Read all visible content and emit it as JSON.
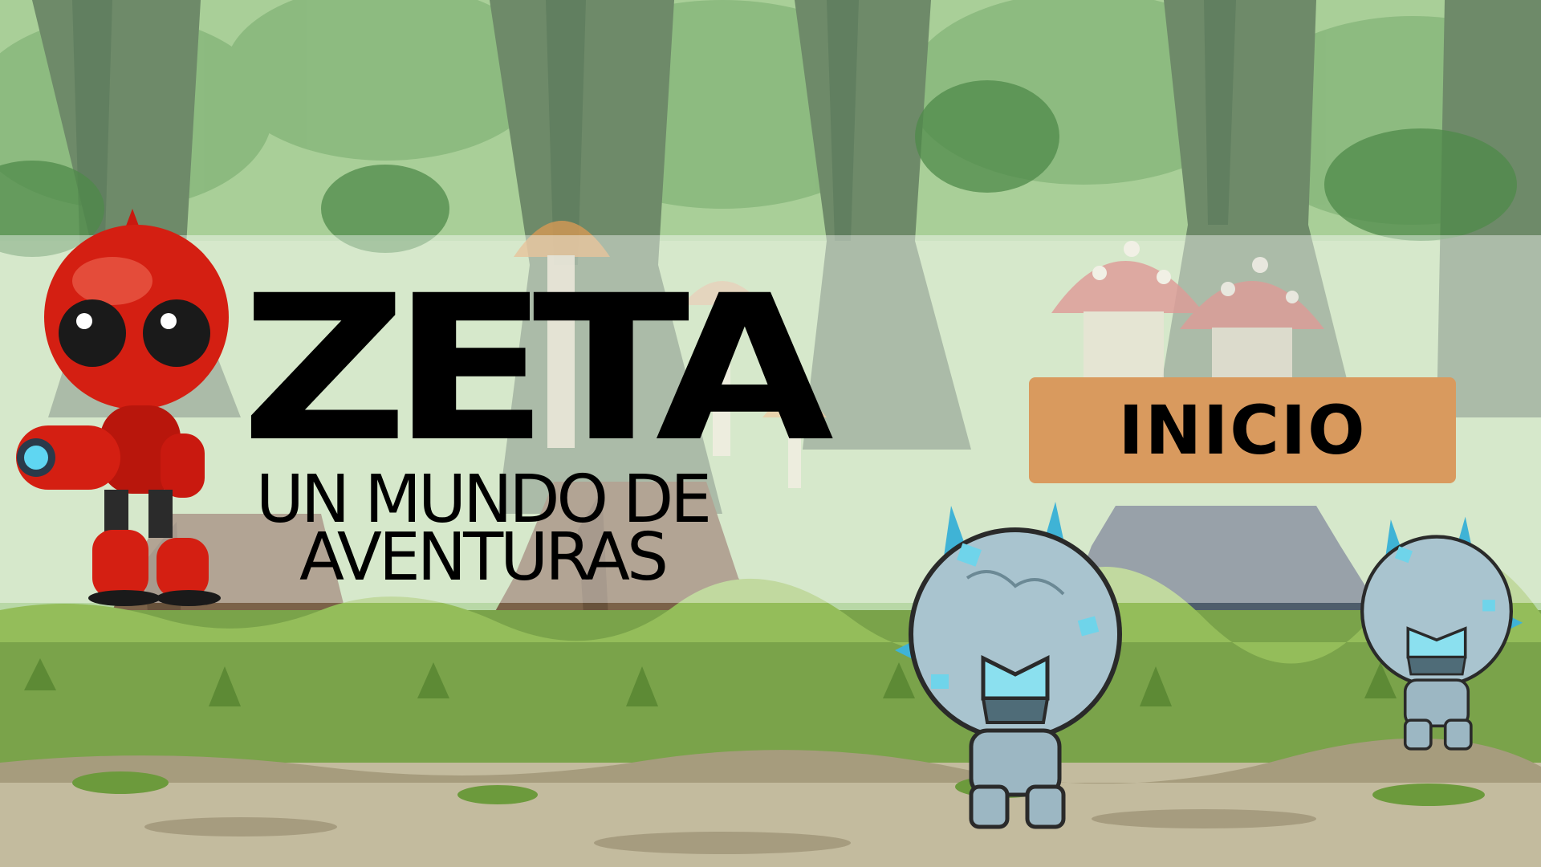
{
  "game": {
    "title": "ZETA",
    "subtitle_line1": "UN MUNDO DE",
    "subtitle_line2": "AVENTURAS"
  },
  "menu": {
    "start_label": "INICIO"
  },
  "colors": {
    "start_button": "#d99a5e",
    "robot": "#d41f12",
    "enemy": "#a9c4cf",
    "grass": "#6f9a3a",
    "forest": "#9fc48f"
  },
  "icons": {
    "player": "red-robot-icon",
    "enemy": "ice-monster-icon"
  }
}
